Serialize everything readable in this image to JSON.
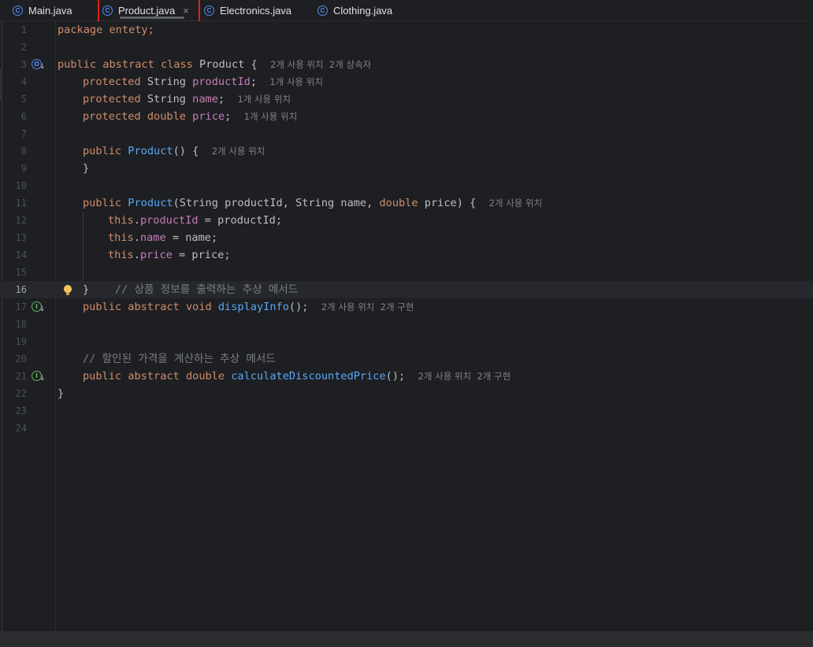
{
  "tabs": [
    {
      "label": "Main.java",
      "icon": "class-icon"
    },
    {
      "label": "Product.java",
      "icon": "class-icon",
      "active": true,
      "close": "×"
    },
    {
      "label": "Electronics.java",
      "icon": "class-icon"
    },
    {
      "label": "Clothing.java",
      "icon": "class-icon"
    }
  ],
  "icon_glyph": "C",
  "gutter": {
    "override_glyph": "O",
    "impl_glyph": "I",
    "arrow": "↓"
  },
  "lines": {
    "l1": {
      "n": "1",
      "t1": "package entety;"
    },
    "l2": {
      "n": "2"
    },
    "l3": {
      "n": "3",
      "kw": "public abstract class",
      "t1": " Product {  ",
      "hint": "2개 사용 위치  2개 상속자"
    },
    "l4": {
      "n": "4",
      "kw": "protected",
      "t1": " String ",
      "fld": "productId",
      "t2": ";  ",
      "hint": "1개 사용 위치"
    },
    "l5": {
      "n": "5",
      "kw": "protected",
      "t1": " String ",
      "fld": "name",
      "t2": ";  ",
      "hint": "1개 사용 위치"
    },
    "l6": {
      "n": "6",
      "kw": "protected double",
      "t1": " ",
      "fld": "price",
      "t2": ";  ",
      "hint": "1개 사용 위치"
    },
    "l7": {
      "n": "7"
    },
    "l8": {
      "n": "8",
      "kw": "public",
      "t1": " ",
      "fn": "Product",
      "t2": "() {  ",
      "hint": "2개 사용 위치"
    },
    "l9": {
      "n": "9",
      "t1": "}"
    },
    "l10": {
      "n": "10"
    },
    "l11": {
      "n": "11",
      "kw": "public",
      "t1": " ",
      "fn": "Product",
      "t2": "(String productId, String name, ",
      "kw2": "double",
      "t3": " price) {  ",
      "hint": "2개 사용 위치"
    },
    "l12": {
      "n": "12",
      "kw": "this",
      "t1": ".",
      "fld": "productId",
      "t2": " = productId;"
    },
    "l13": {
      "n": "13",
      "kw": "this",
      "t1": ".",
      "fld": "name",
      "t2": " = name;"
    },
    "l14": {
      "n": "14",
      "kw": "this",
      "t1": ".",
      "fld": "price",
      "t2": " = price;"
    },
    "l15": {
      "n": "15"
    },
    "l16": {
      "n": "16",
      "t1": "}    ",
      "cm": "// 상품 정보를 출력하는 추상 메서드"
    },
    "l17": {
      "n": "17",
      "kw": "public abstract void",
      "t1": " ",
      "fn": "displayInfo",
      "t2": "();  ",
      "hint": "2개 사용 위치  2개 구현"
    },
    "l18": {
      "n": "18"
    },
    "l19": {
      "n": "19"
    },
    "l20": {
      "n": "20",
      "cm": "// 할인된 가격을 계산하는 추상 메서드"
    },
    "l21": {
      "n": "21",
      "kw": "public abstract double",
      "t1": " ",
      "fn": "calculateDiscountedPrice",
      "t2": "();  ",
      "hint": "2개 사용 위치  2개 구현"
    },
    "l22": {
      "n": "22",
      "t1": "}"
    },
    "l23": {
      "n": "23"
    },
    "l24": {
      "n": "24"
    }
  }
}
